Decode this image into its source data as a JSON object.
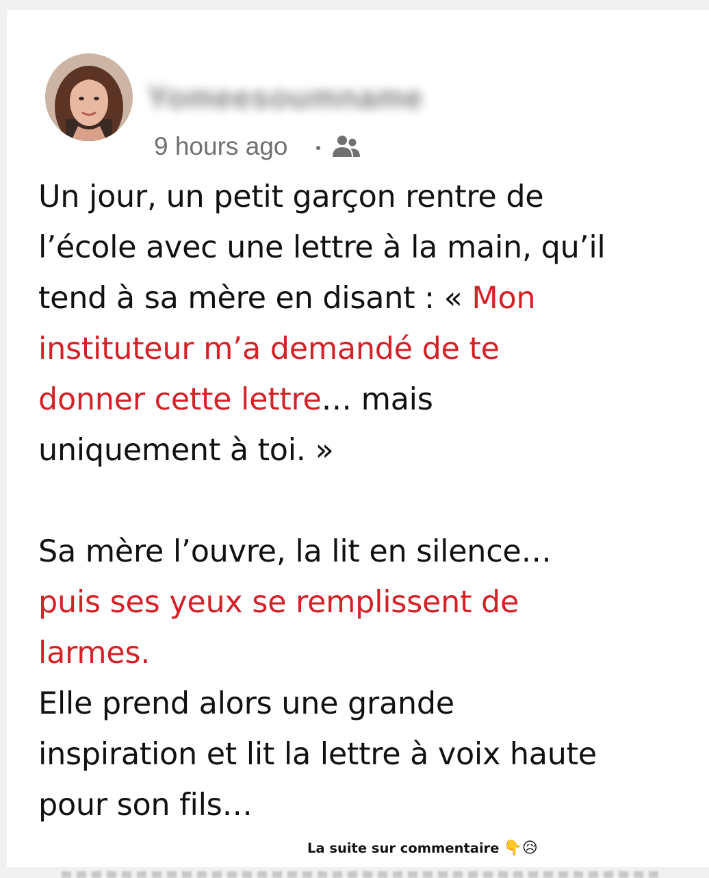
{
  "post": {
    "author_name": "Yomeesoumname",
    "timestamp": "9 hours ago",
    "audience_icon": "friends-icon",
    "avatar_icon": "profile-photo",
    "lines": [
      [
        {
          "text": "Un jour, un petit garçon rentre de",
          "red": false
        }
      ],
      [
        {
          "text": "l’école avec une lettre à la main, qu’il",
          "red": false
        }
      ],
      [
        {
          "text": "tend à sa mère en disant : « ",
          "red": false
        },
        {
          "text": "Mon",
          "red": true
        }
      ],
      [
        {
          "text": "instituteur m’a demandé de te",
          "red": true
        }
      ],
      [
        {
          "text": "donner cette lettre",
          "red": true
        },
        {
          "text": "… mais",
          "red": false
        }
      ],
      [
        {
          "text": "uniquement à toi. »",
          "red": false
        }
      ],
      [],
      [
        {
          "text": "Sa mère l’ouvre, la lit en silence…",
          "red": false
        }
      ],
      [
        {
          "text": "puis ses yeux se remplissent de",
          "red": true
        }
      ],
      [
        {
          "text": "larmes.",
          "red": true
        }
      ],
      [
        {
          "text": "Elle prend alors une grande",
          "red": false
        }
      ],
      [
        {
          "text": "inspiration et lit la lettre à voix haute",
          "red": false
        }
      ],
      [
        {
          "text": "pour son fils…",
          "red": false
        }
      ]
    ]
  },
  "footer": {
    "caption": "La suite sur commentaire",
    "emoji": "👇😥"
  },
  "colors": {
    "accent_red": "#d42127",
    "text": "#111111",
    "meta_gray": "#707070"
  }
}
